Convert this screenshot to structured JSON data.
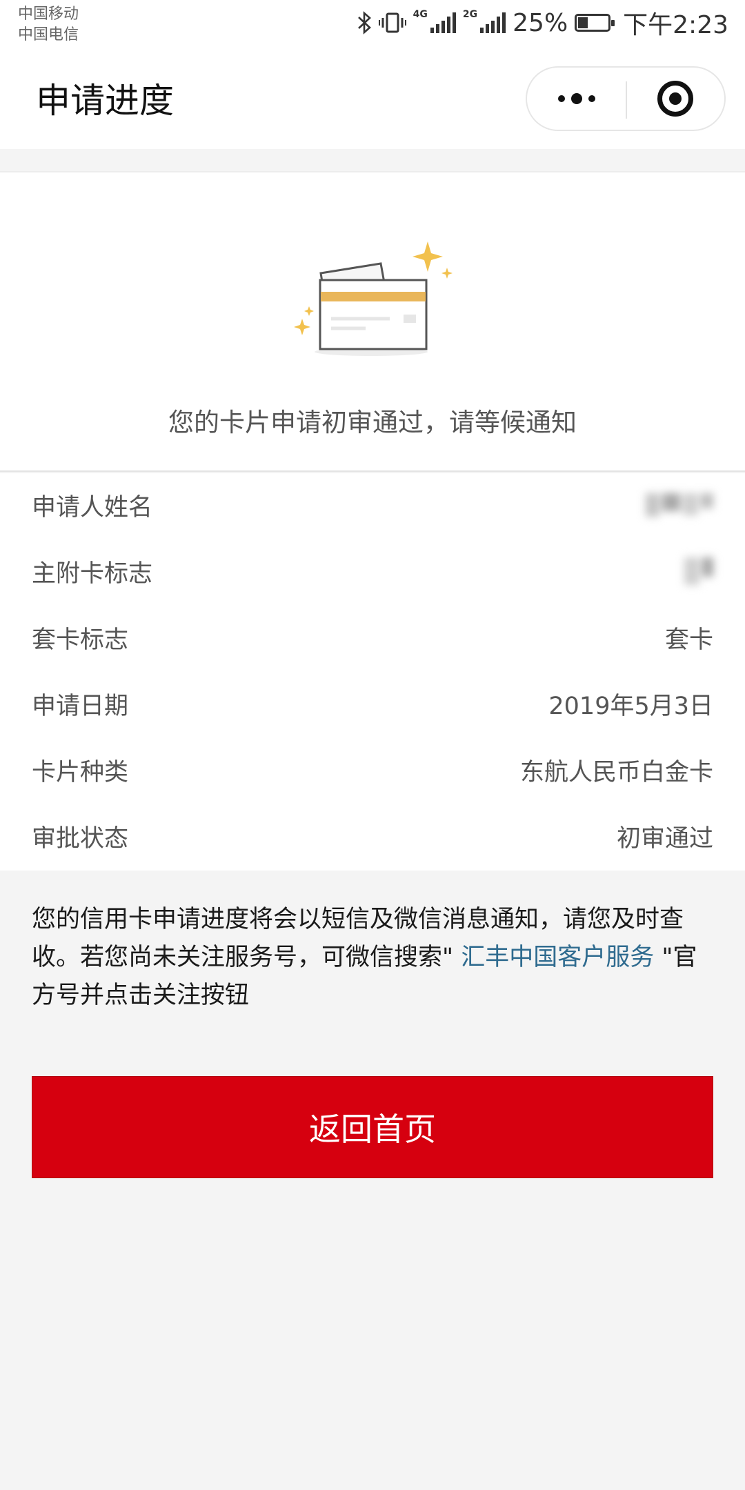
{
  "status_bar": {
    "carrier_1": "中国移动",
    "carrier_2": "中国电信",
    "network_1": "4G",
    "network_2": "2G",
    "battery": "25%",
    "time": "下午2:23"
  },
  "nav": {
    "title": "申请进度"
  },
  "hero": {
    "message": "您的卡片申请初审通过，请等候通知"
  },
  "details": [
    {
      "label": "申请人姓名",
      "value": ""
    },
    {
      "label": "主附卡标志",
      "value": ""
    },
    {
      "label": "套卡标志",
      "value": "套卡"
    },
    {
      "label": "申请日期",
      "value": "2019年5月3日"
    },
    {
      "label": "卡片种类",
      "value": "东航人民币白金卡"
    },
    {
      "label": "审批状态",
      "value": "初审通过"
    }
  ],
  "notice": {
    "text_before": "您的信用卡申请进度将会以短信及微信消息通知，请您及时查收。若您尚未关注服务号，可微信搜索\" ",
    "link": "汇丰中国客户服务",
    "text_after": " \"官方号并点击关注按钮"
  },
  "actions": {
    "home_label": "返回首页"
  },
  "colors": {
    "primary_button": "#d6000f",
    "link": "#2f6b8f",
    "card_stripe": "#e9b65a",
    "sparkle": "#f2c14e"
  },
  "icons": [
    "bluetooth-icon",
    "vibrate-icon",
    "signal-icon",
    "battery-icon",
    "more-icon",
    "close-target-icon",
    "credit-card-illustration"
  ]
}
